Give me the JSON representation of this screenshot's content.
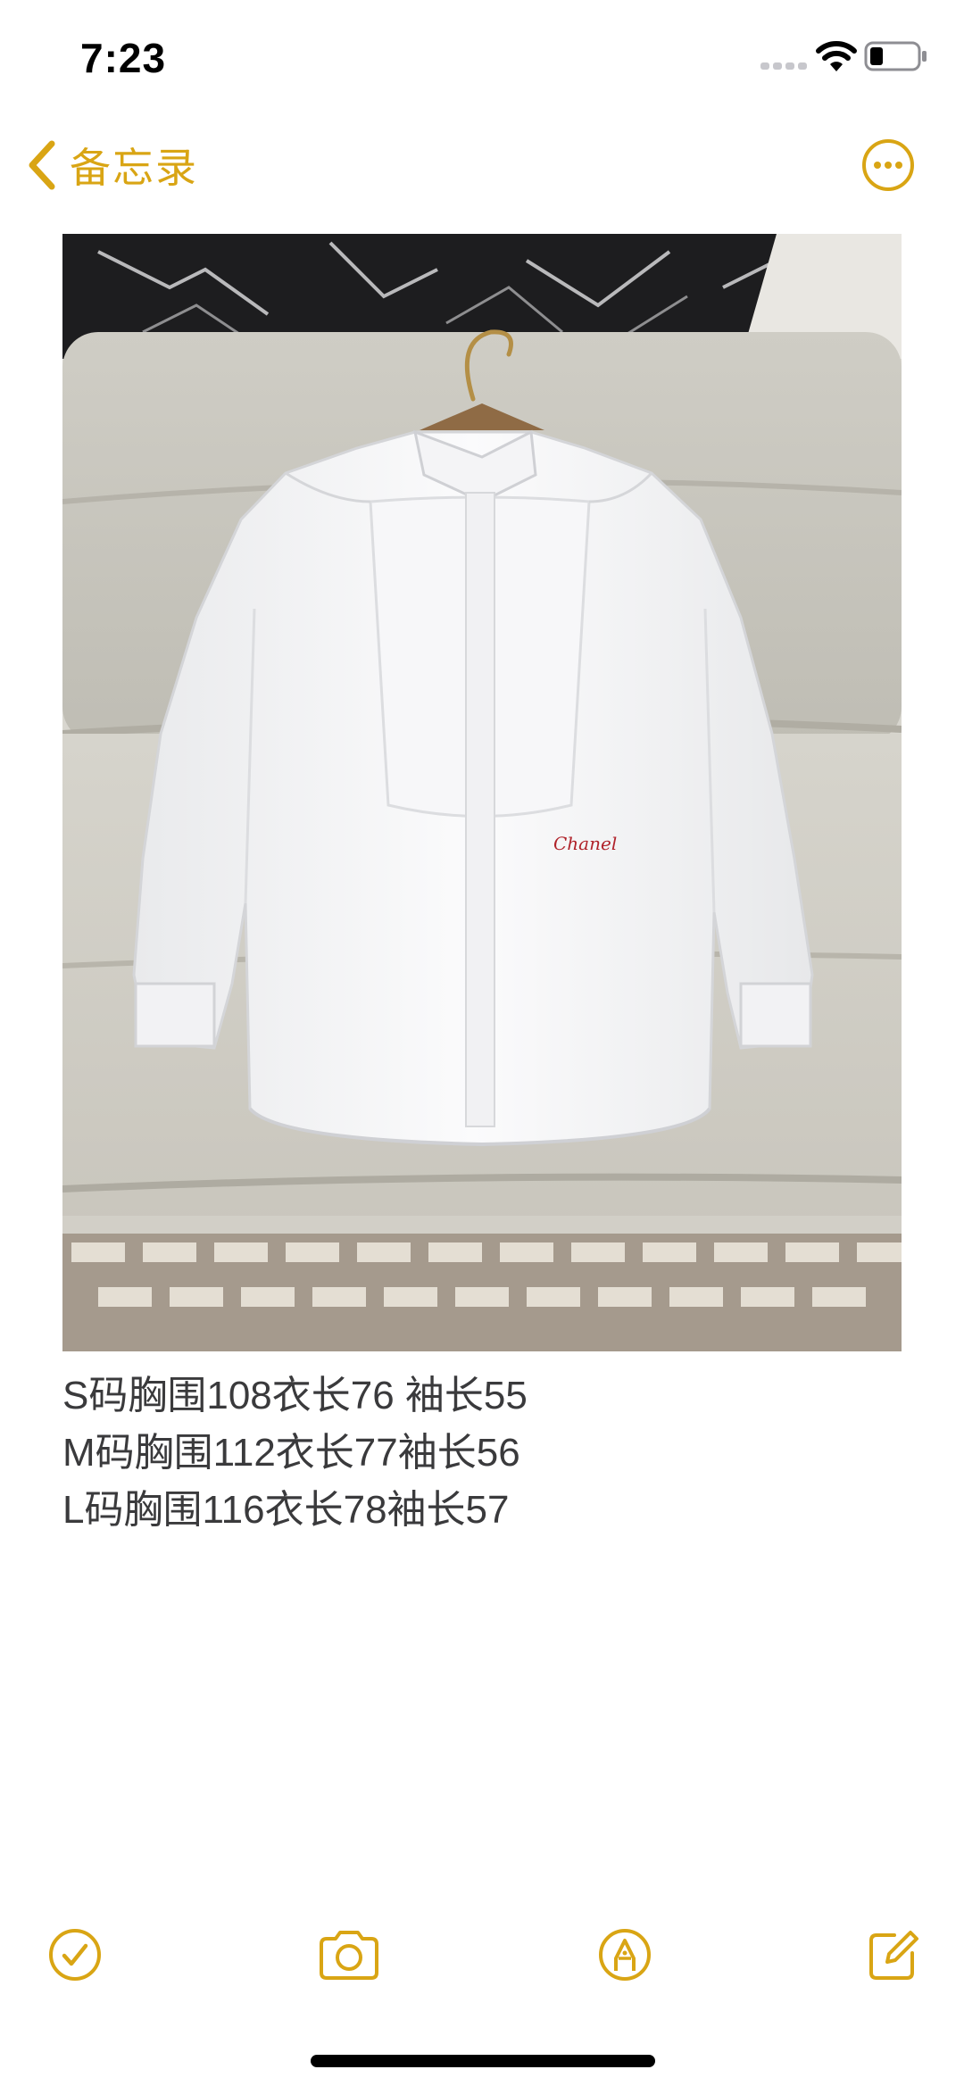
{
  "status_bar": {
    "time": "7:23"
  },
  "nav": {
    "back_label": "备忘录",
    "more_icon": "ellipsis-circle-icon"
  },
  "photo": {
    "subject": "white-shirt-on-hanger",
    "embroidery_text": "Chanel",
    "embroidery_color": "#b0222a"
  },
  "note": {
    "lines": [
      "S码胸围108衣长76 袖长55",
      "M码胸围112衣长77袖长56",
      "L码胸围116衣长78袖长57"
    ]
  },
  "toolbar": {
    "checklist_icon": "checkmark-circle-icon",
    "camera_icon": "camera-icon",
    "markup_icon": "pen-circle-icon",
    "compose_icon": "compose-icon"
  },
  "colors": {
    "accent": "#d9a514",
    "text": "#3a3a3c",
    "background": "#ffffff"
  }
}
